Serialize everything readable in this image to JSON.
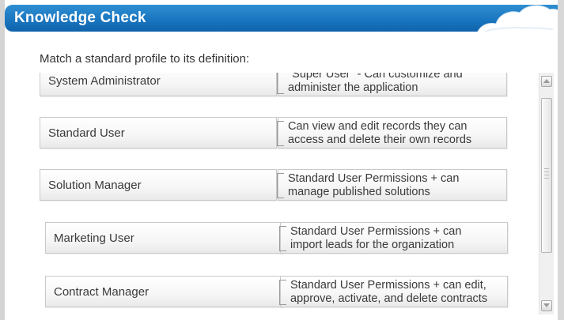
{
  "header": {
    "title": "Knowledge Check"
  },
  "prompt": "Match a standard profile to its definition:",
  "pairs": [
    {
      "term": "System Administrator",
      "definition_line1": "\"Super User\" - Can customize and",
      "definition_line2": "administer the application"
    },
    {
      "term": "Standard User",
      "definition_line1": "Can view and edit records they can",
      "definition_line2": "access and delete their own records"
    },
    {
      "term": "Solution Manager",
      "definition_line1": "Standard User Permissions + can",
      "definition_line2": "manage published solutions"
    },
    {
      "term": "Marketing User",
      "definition_line1": "Standard User Permissions + can",
      "definition_line2": "import leads for the organization"
    },
    {
      "term": "Contract Manager",
      "definition_line1": "Standard User Permissions + can edit,",
      "definition_line2": "approve, activate, and delete contracts"
    }
  ],
  "icons": {
    "header_decoration": "cloud-icon",
    "scroll_up": "scroll-up-arrow-icon",
    "scroll_down": "scroll-down-arrow-icon"
  },
  "colors": {
    "header": "#1a76c0",
    "text": "#3a3a3a"
  }
}
